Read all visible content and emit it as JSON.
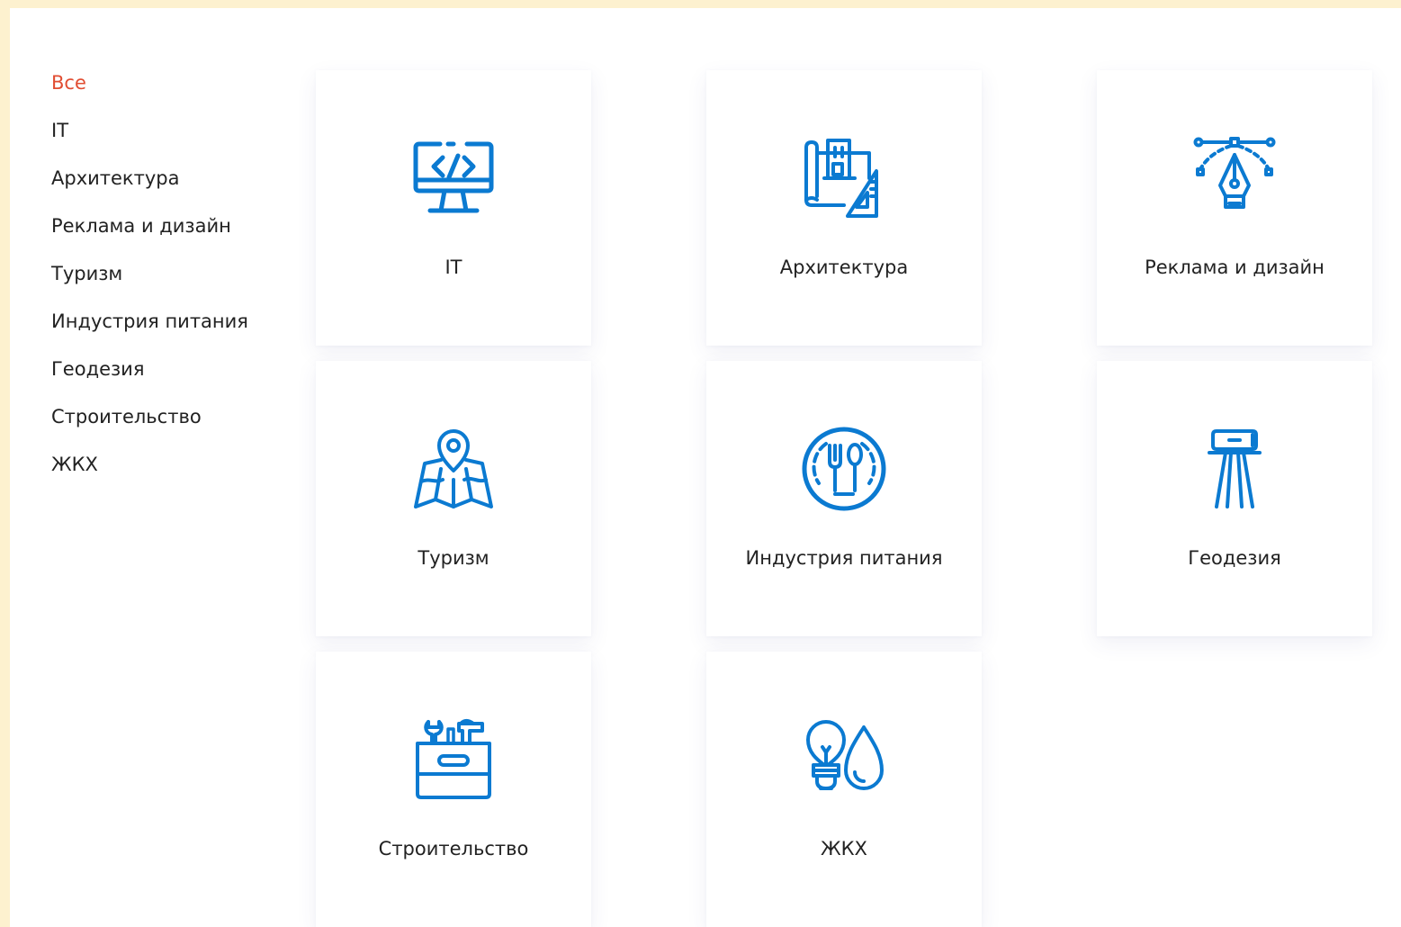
{
  "theme": {
    "accent": "#e14d32",
    "icon_color": "#0b7ad1",
    "frame": "#fdf1cf"
  },
  "sidebar": {
    "items": [
      {
        "label": "Все",
        "active": true
      },
      {
        "label": "IT"
      },
      {
        "label": "Архитектура"
      },
      {
        "label": "Реклама и дизайн"
      },
      {
        "label": "Туризм"
      },
      {
        "label": "Индустрия питания"
      },
      {
        "label": "Геодезия"
      },
      {
        "label": "Строительство"
      },
      {
        "label": "ЖКХ"
      }
    ]
  },
  "cards": [
    {
      "label": "IT",
      "icon": "code-monitor-icon"
    },
    {
      "label": "Архитектура",
      "icon": "architecture-blueprint-icon"
    },
    {
      "label": "Реклама и дизайн",
      "icon": "pen-tool-bezier-icon"
    },
    {
      "label": "Туризм",
      "icon": "map-location-pin-icon"
    },
    {
      "label": "Индустрия питания",
      "icon": "plate-fork-spoon-icon"
    },
    {
      "label": "Геодезия",
      "icon": "surveyor-tripod-icon"
    },
    {
      "label": "Строительство",
      "icon": "toolbox-icon"
    },
    {
      "label": "ЖКХ",
      "icon": "lightbulb-water-drop-icon"
    }
  ]
}
